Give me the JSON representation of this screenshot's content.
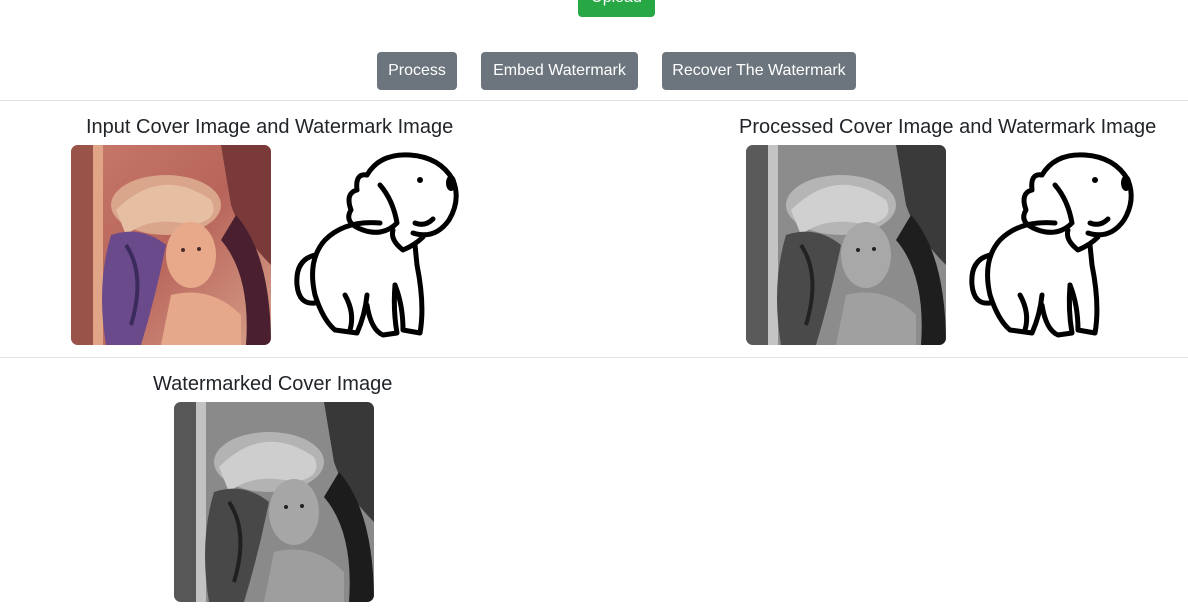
{
  "toolbar": {
    "upload_label": "Upload",
    "process_label": "Process",
    "embed_label": "Embed Watermark",
    "recover_label": "Recover The Watermark"
  },
  "sections": {
    "input_title": "Input Cover Image and Watermark Image",
    "processed_title": "Processed Cover Image and Watermark Image",
    "watermarked_title": "Watermarked Cover Image"
  },
  "colors": {
    "button_gray": "#6c757d",
    "button_green": "#28a745",
    "divider": "#dee2e6"
  }
}
